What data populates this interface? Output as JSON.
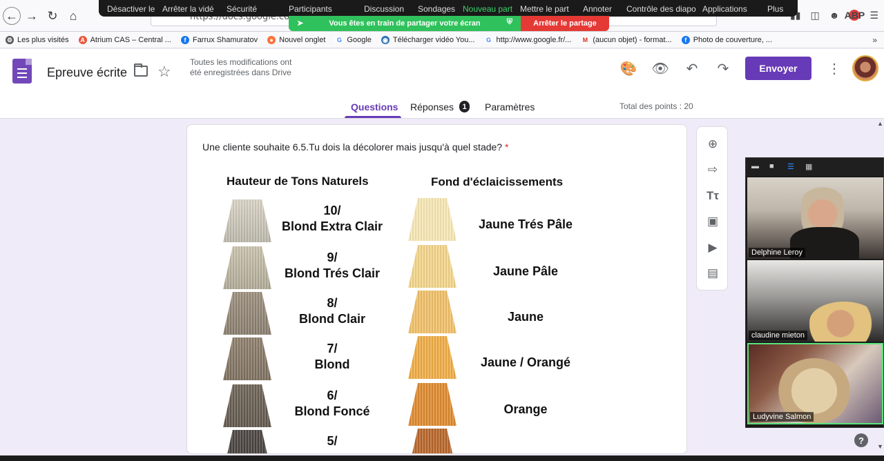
{
  "browser": {
    "url": "https://docs.google.com/",
    "abp_label": "ABP"
  },
  "zoom_toolbar": {
    "items": [
      "Désactiver le",
      "Arrêter la vidé",
      "Sécurité",
      "Participants",
      "Discussion",
      "Sondages",
      "Nouveau part",
      "Mettre le part",
      "Annoter",
      "Contrôle des diapo",
      "Applications",
      "Plus"
    ],
    "share_message": "Vous êtes en train de partager votre écran",
    "stop_share_label": "Arrêter le partage"
  },
  "bookmarks": [
    {
      "label": "Les plus visités",
      "icon": "gear-icon",
      "color": "#555555"
    },
    {
      "label": "Atrium CAS – Central ...",
      "icon": "atrium-icon",
      "color": "#e8573c"
    },
    {
      "label": "Farrux Shamuratov",
      "icon": "facebook-icon",
      "color": "#1877f2"
    },
    {
      "label": "Nouvel onglet",
      "icon": "firefox-icon",
      "color": "#ff7139"
    },
    {
      "label": "Google",
      "icon": "google-icon",
      "color": "#4285f4"
    },
    {
      "label": "Télécharger vidéo You...",
      "icon": "globe-icon",
      "color": "#2a6fb5"
    },
    {
      "label": "http://www.google.fr/...",
      "icon": "google-icon",
      "color": "#4285f4"
    },
    {
      "label": "(aucun objet) - format...",
      "icon": "gmail-icon",
      "color": "#d93025"
    },
    {
      "label": "Photo de couverture, ...",
      "icon": "facebook-icon",
      "color": "#1877f2"
    }
  ],
  "forms": {
    "title": "Epreuve écrite",
    "save_status": "Toutes les modifications ont été enregistrées dans Drive",
    "send_label": "Envoyer",
    "tabs": [
      {
        "label": "Questions",
        "active": true
      },
      {
        "label": "Réponses",
        "active": false,
        "badge": "1"
      },
      {
        "label": "Paramètres",
        "active": false
      }
    ],
    "total_points": "Total des points : 20",
    "accent_color": "#673ab7"
  },
  "question": {
    "text": "Une cliente souhaite 6.5.Tu dois la décolorer mais jusqu'à quel stade?",
    "required_mark": "*"
  },
  "chart": {
    "left_title": "Hauteur de Tons Naturels",
    "right_title": "Fond d'éclaicissements",
    "levels": [
      {
        "number": "10/",
        "name": "Blond Extra Clair",
        "hair_color": "#d8d3c4",
        "fond": "Jaune Trés Pâle",
        "fond_color": "#f6e7b4"
      },
      {
        "number": "9/",
        "name": "Blond Trés Clair",
        "hair_color": "#c9c2ac",
        "fond": "Jaune Pâle",
        "fond_color": "#f3d58a"
      },
      {
        "number": "8/",
        "name": "Blond Clair",
        "hair_color": "#9c8f7d",
        "fond": "Jaune",
        "fond_color": "#f0c069"
      },
      {
        "number": "7/",
        "name": "Blond",
        "hair_color": "#8e7f6c",
        "fond": "Jaune / Orangé",
        "fond_color": "#efac45"
      },
      {
        "number": "6/",
        "name": "Blond Foncé",
        "hair_color": "#6e6457",
        "fond": "Orange",
        "fond_color": "#de8a2f"
      },
      {
        "number": "5/",
        "name": "",
        "hair_color": "#4d4743",
        "fond": "",
        "fond_color": "#b8662b"
      }
    ]
  },
  "video_panel": {
    "participants": [
      {
        "name": "Delphine Leroy"
      },
      {
        "name": "claudine mieton"
      },
      {
        "name": "Ludyvine Salmon"
      }
    ]
  },
  "help_label": "?"
}
